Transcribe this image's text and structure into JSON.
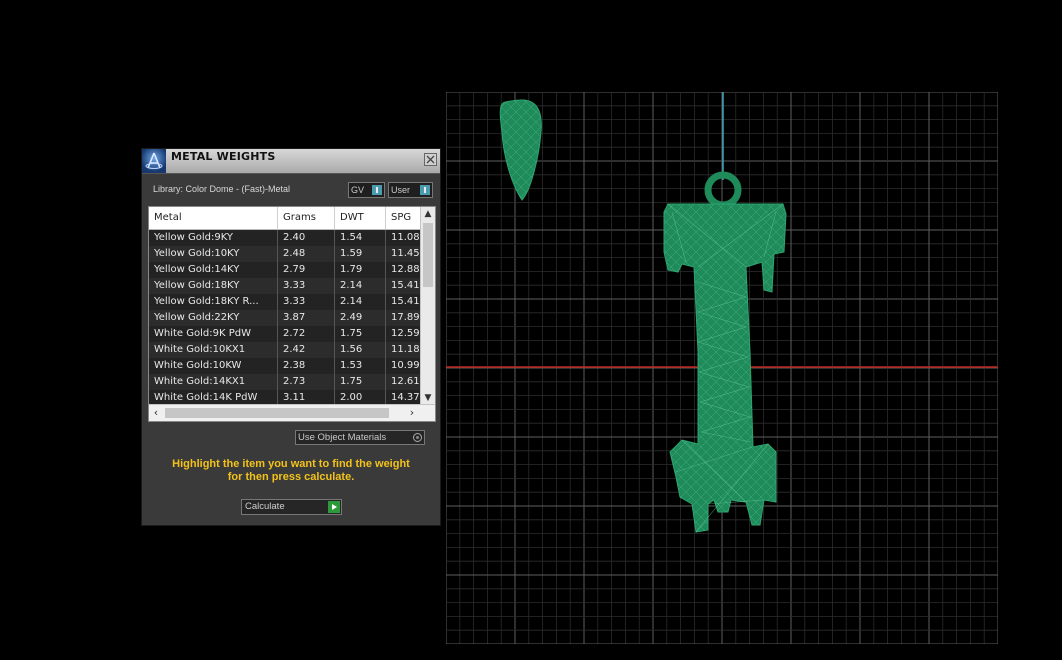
{
  "panel": {
    "title": "METAL WEIGHTS",
    "library_label": "Library: Color Dome - (Fast)-Metal",
    "toggle_gv": "GV",
    "toggle_user": "User",
    "table": {
      "columns": [
        "Metal",
        "Grams",
        "DWT",
        "SPG"
      ],
      "rows": [
        [
          "Yellow Gold:9KY",
          "2.40",
          "1.54",
          "11.08"
        ],
        [
          "Yellow Gold:10KY",
          "2.48",
          "1.59",
          "11.45"
        ],
        [
          "Yellow Gold:14KY",
          "2.79",
          "1.79",
          "12.88"
        ],
        [
          "Yellow Gold:18KY",
          "3.33",
          "2.14",
          "15.41"
        ],
        [
          "Yellow Gold:18KY R...",
          "3.33",
          "2.14",
          "15.41"
        ],
        [
          "Yellow Gold:22KY",
          "3.87",
          "2.49",
          "17.89"
        ],
        [
          "White Gold:9K PdW",
          "2.72",
          "1.75",
          "12.59"
        ],
        [
          "White Gold:10KX1",
          "2.42",
          "1.56",
          "11.18"
        ],
        [
          "White Gold:10KW",
          "2.38",
          "1.53",
          "10.99"
        ],
        [
          "White Gold:14KX1",
          "2.73",
          "1.75",
          "12.61"
        ],
        [
          "White Gold:14K PdW",
          "3.11",
          "2.00",
          "14.37"
        ]
      ]
    },
    "use_object_materials": "Use Object Materials",
    "instruction_line1": "Highlight the item you want to find the weight",
    "instruction_line2": "for then press calculate.",
    "calculate_label": "Calculate"
  },
  "viewport": {
    "grid_color": "#2c2c2c",
    "major_grid_color": "#5e5e5e",
    "axis_y_color": "#3aa6b9",
    "axis_x_color": "#c0261f",
    "model_color": "#1f8a5a"
  }
}
